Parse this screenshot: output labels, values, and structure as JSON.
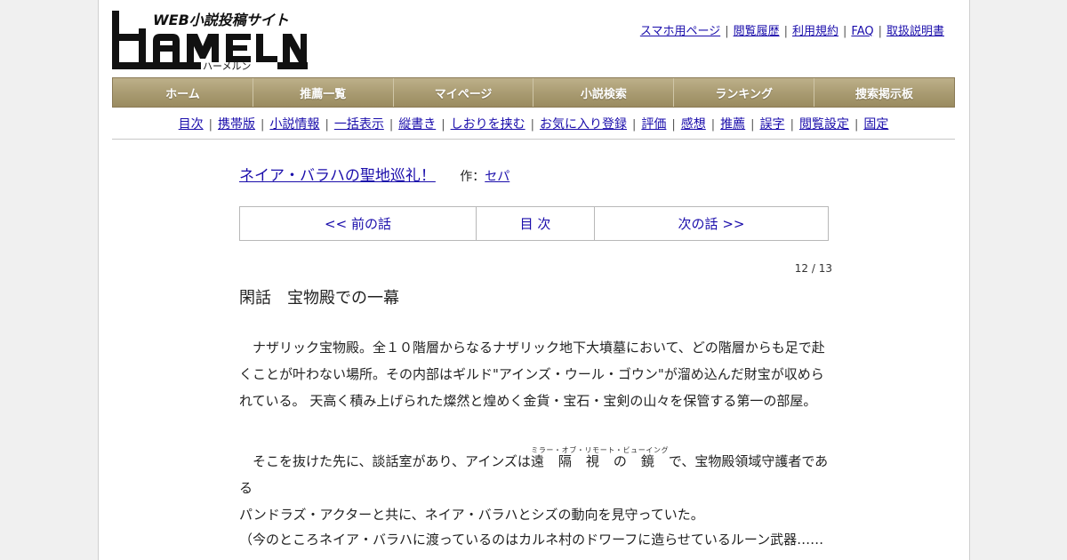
{
  "header": {
    "logo": {
      "tagline": "WEB小説投稿サイト",
      "wordmark": "HAMELN",
      "kana": "ハーメルン"
    },
    "toplinks": [
      {
        "label": "スマホ用ページ"
      },
      {
        "label": "閲覧履歴"
      },
      {
        "label": "利用規約"
      },
      {
        "label": "FAQ"
      },
      {
        "label": "取扱説明書"
      }
    ]
  },
  "mainnav": [
    {
      "label": "ホーム"
    },
    {
      "label": "推薦一覧"
    },
    {
      "label": "マイページ"
    },
    {
      "label": "小説検索"
    },
    {
      "label": "ランキング"
    },
    {
      "label": "捜索掲示板"
    }
  ],
  "subnav": [
    {
      "label": "目次"
    },
    {
      "label": "携帯版"
    },
    {
      "label": "小説情報"
    },
    {
      "label": "一括表示"
    },
    {
      "label": "縦書き"
    },
    {
      "label": "しおりを挟む"
    },
    {
      "label": "お気に入り登録"
    },
    {
      "label": "評価"
    },
    {
      "label": "感想"
    },
    {
      "label": "推薦"
    },
    {
      "label": "誤字"
    },
    {
      "label": "閲覧設定"
    },
    {
      "label": "固定"
    }
  ],
  "novel": {
    "title": "ネイア・バラハの聖地巡礼！",
    "author_label": "作：",
    "author": "セパ"
  },
  "pager": {
    "prev": "<< 前の話",
    "toc": "目 次",
    "next": "次の話 >>"
  },
  "counter": "12 / 13",
  "chapter_title": "閑話　宝物殿での一幕",
  "body": {
    "p1_line1": "　ナザリック宝物殿。全１０階層からなるナザリック地下大墳墓において、どの階層からも足で赴",
    "p1_line2": "くことが叶わない場所。その内部はギルド\"アインズ・ウール・ゴウン\"が溜め込んだ財宝が収めら",
    "p1_line3": "れている。 天高く積み上げられた燦然と煌めく金貨・宝石・宝剣の山々を保管する第一の部屋。",
    "p2_line1_before": "　そこを抜けた先に、談話室があり、アインズは",
    "p2_ruby_base": "遠隔視の鏡",
    "p2_ruby_text": "ミラー・オブ・リモート・ビューイング",
    "p2_line1_after": "で、宝物殿領域守護者である",
    "p2_line2": "パンドラズ・アクターと共に、ネイア・バラハとシズの動向を見守っていた。",
    "p3_line1": "（今のところネイア・バラハに渡っているのはカルネ村のドワーフに造らせているルーン武器……"
  },
  "colors": {
    "link": "#1a0dab",
    "nav_gold": "#a89a70",
    "logo_black": "#111111"
  }
}
